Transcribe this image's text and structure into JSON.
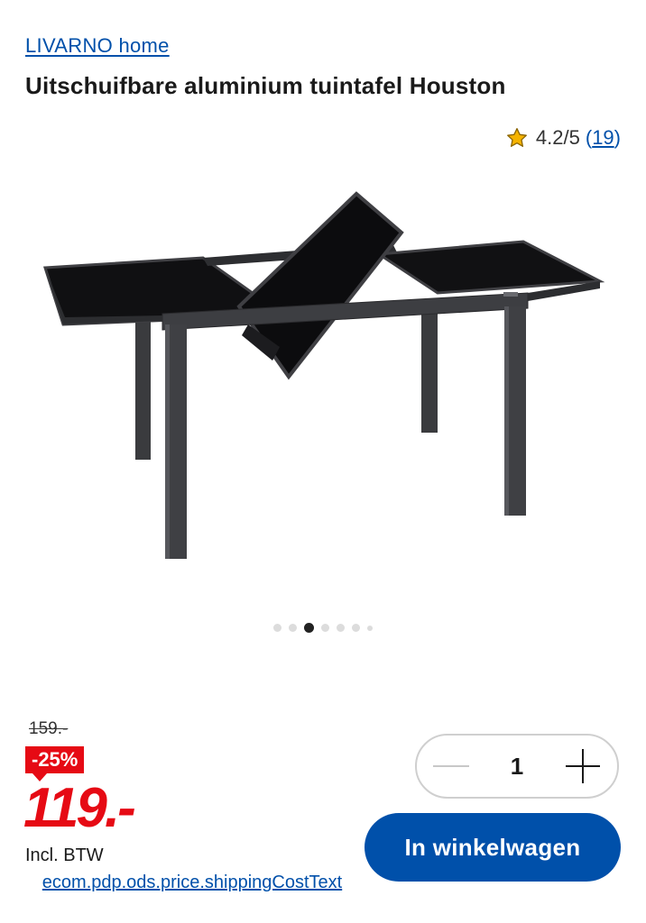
{
  "brand": {
    "name": "LIVARNO home"
  },
  "product": {
    "title": "Uitschuifbare aluminium tuintafel Houston"
  },
  "rating": {
    "score": "4.2/5",
    "count_open": "(",
    "count": "19",
    "count_close": ")",
    "star_color": "#f5b300",
    "icon": "star-icon"
  },
  "carousel": {
    "total": 7,
    "active_index": 2
  },
  "pricing": {
    "old_price": "159.-",
    "discount": "-25%",
    "price": "119.-",
    "tax_note": "Incl. BTW",
    "shipping_text": "ecom.pdp.ods.price.shippingCostText"
  },
  "quantity": {
    "value": "1",
    "minus_icon": "minus-icon",
    "plus_icon": "plus-icon"
  },
  "cart": {
    "button_label": "In winkelwagen"
  },
  "colors": {
    "brand_blue": "#0050aa",
    "sale_red": "#e60a14"
  }
}
